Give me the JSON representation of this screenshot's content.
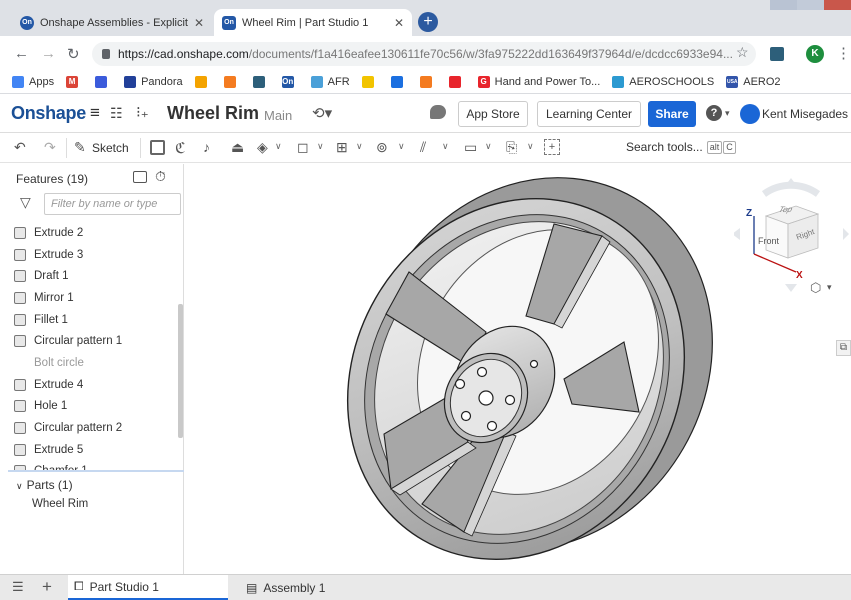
{
  "browser": {
    "tabs": [
      {
        "title": "Onshape Assemblies - Explicit M",
        "active": false
      },
      {
        "title": "Wheel Rim | Part Studio 1",
        "active": true
      }
    ],
    "url_host": "https://cad.onshape.com",
    "url_rest": "/documents/f1a416eafee130611fe70c56/w/3fa975222dd163649f37964d/e/dcdcc6933e94...",
    "profile_initial": "K"
  },
  "bookmarks": [
    {
      "label": "Apps",
      "color": "#4285f4"
    },
    {
      "label": "",
      "color": "#db4437",
      "glyph": "M"
    },
    {
      "label": "",
      "color": "#3b5bdb"
    },
    {
      "label": "Pandora",
      "color": "#224099"
    },
    {
      "label": "",
      "color": "#f4a300"
    },
    {
      "label": "",
      "color": "#f47b20"
    },
    {
      "label": "",
      "color": "#2d5f7a"
    },
    {
      "label": "",
      "color": "#2458a6",
      "glyph": "On"
    },
    {
      "label": "AFR",
      "color": "#4aa0d8"
    },
    {
      "label": "",
      "color": "#f2c400"
    },
    {
      "label": "",
      "color": "#1b6fe0"
    },
    {
      "label": "",
      "color": "#f47b20"
    },
    {
      "label": "",
      "color": "#e8252c"
    },
    {
      "label": "Hand and Power To...",
      "color": "#e8252c",
      "glyph": "G"
    },
    {
      "label": "AEROSCHOOLS",
      "color": "#2c9ad1"
    },
    {
      "label": "AERO2",
      "color": "#3355aa",
      "glyph": "USA"
    }
  ],
  "app": {
    "logo": "Onshape",
    "doc_name": "Wheel Rim",
    "workspace": "Main",
    "app_store": "App Store",
    "learning_center": "Learning Center",
    "share": "Share",
    "user": "Kent Misegades"
  },
  "toolbar": {
    "sketch": "Sketch",
    "search_tools": "Search tools...",
    "search_kbd1": "alt",
    "search_kbd2": "C"
  },
  "features": {
    "title": "Features (19)",
    "filter_placeholder": "Filter by name or type",
    "items": [
      {
        "label": "Extrude 2",
        "dim": false
      },
      {
        "label": "Extrude 3",
        "dim": false
      },
      {
        "label": "Draft 1",
        "dim": false
      },
      {
        "label": "Mirror 1",
        "dim": false
      },
      {
        "label": "Fillet 1",
        "dim": false
      },
      {
        "label": "Circular pattern 1",
        "dim": false
      },
      {
        "label": "Bolt circle",
        "dim": true
      },
      {
        "label": "Extrude 4",
        "dim": false
      },
      {
        "label": "Hole 1",
        "dim": false
      },
      {
        "label": "Circular pattern 2",
        "dim": false
      },
      {
        "label": "Extrude 5",
        "dim": false
      },
      {
        "label": "Chamfer 1",
        "dim": false
      }
    ]
  },
  "parts": {
    "title": "Parts (1)",
    "items": [
      "Wheel Rim"
    ]
  },
  "viewcube": {
    "top": "Top",
    "front": "Front",
    "right": "Right",
    "axis_z": "Z",
    "axis_x": "X"
  },
  "bottom_tabs": [
    {
      "label": "Part Studio 1",
      "active": true
    },
    {
      "label": "Assembly 1",
      "active": false
    }
  ]
}
